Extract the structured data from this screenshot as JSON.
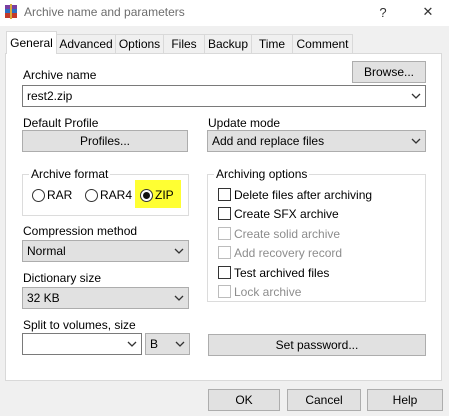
{
  "window": {
    "title": "Archive name and parameters",
    "help_glyph": "?",
    "close_glyph": "✕"
  },
  "tabs": [
    {
      "label": "General",
      "active": true
    },
    {
      "label": "Advanced",
      "active": false
    },
    {
      "label": "Options",
      "active": false
    },
    {
      "label": "Files",
      "active": false
    },
    {
      "label": "Backup",
      "active": false
    },
    {
      "label": "Time",
      "active": false
    },
    {
      "label": "Comment",
      "active": false
    }
  ],
  "general": {
    "archive_name_label": "Archive name",
    "browse_label": "Browse...",
    "archive_name_value": "rest2.zip",
    "default_profile_label": "Default Profile",
    "profiles_label": "Profiles...",
    "update_mode_label": "Update mode",
    "update_mode_value": "Add and replace files",
    "archive_format": {
      "title": "Archive format",
      "options": [
        {
          "label": "RAR",
          "selected": false
        },
        {
          "label": "RAR4",
          "selected": false
        },
        {
          "label": "ZIP",
          "selected": true
        }
      ],
      "highlight_color": "#ffff33"
    },
    "compression_method_label": "Compression method",
    "compression_method_value": "Normal",
    "dictionary_size_label": "Dictionary size",
    "dictionary_size_value": "32 KB",
    "split_label": "Split to volumes, size",
    "split_value": "",
    "split_unit_value": "B",
    "archiving_options": {
      "title": "Archiving options",
      "items": [
        {
          "label": "Delete files after archiving",
          "checked": false,
          "enabled": true
        },
        {
          "label": "Create SFX archive",
          "checked": false,
          "enabled": true
        },
        {
          "label": "Create solid archive",
          "checked": false,
          "enabled": false
        },
        {
          "label": "Add recovery record",
          "checked": false,
          "enabled": false
        },
        {
          "label": "Test archived files",
          "checked": false,
          "enabled": true
        },
        {
          "label": "Lock archive",
          "checked": false,
          "enabled": false
        }
      ]
    },
    "set_password_label": "Set password..."
  },
  "footer": {
    "ok_label": "OK",
    "cancel_label": "Cancel",
    "help_label": "Help"
  },
  "colors": {
    "window_bg": "#f0f0f0",
    "panel_bg": "#ffffff",
    "button_bg": "#e1e1e1",
    "disabled_text": "#8d8d8d"
  }
}
